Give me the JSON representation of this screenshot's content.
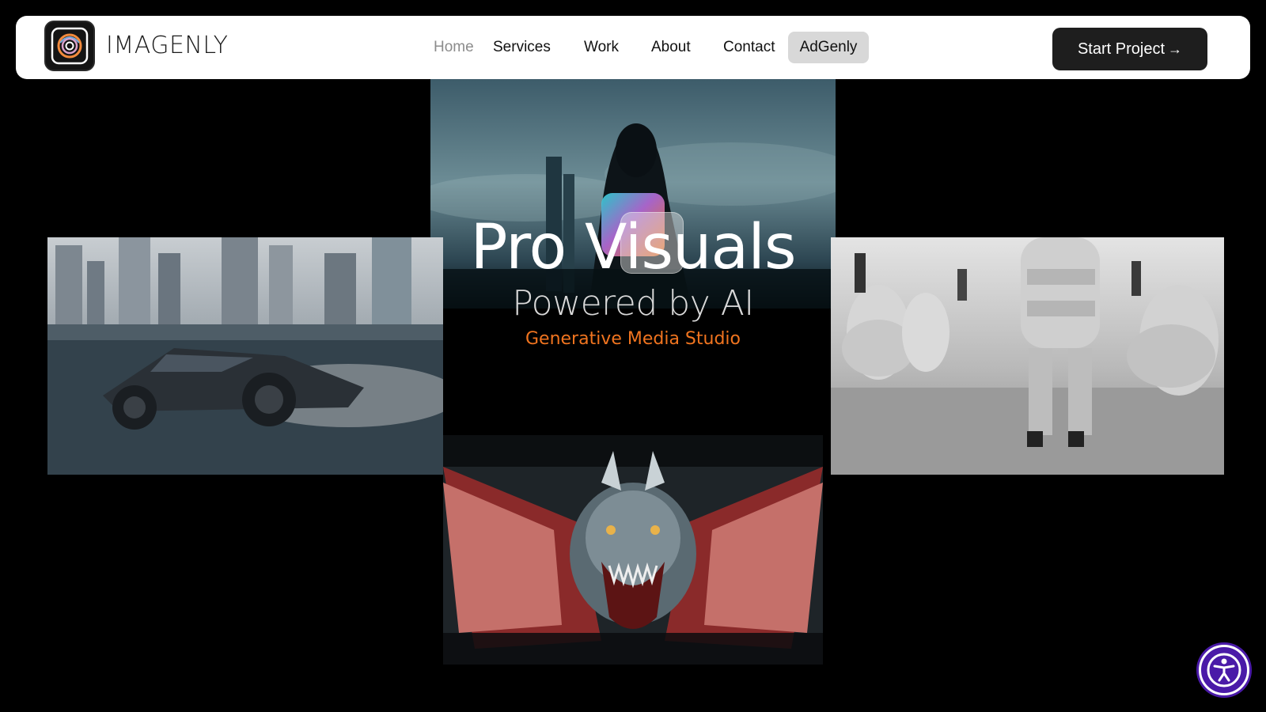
{
  "brand": {
    "name": "IMAGENLY"
  },
  "nav": {
    "items": [
      {
        "label": "Home",
        "state": "active"
      },
      {
        "label": "Services"
      },
      {
        "label": "Work"
      },
      {
        "label": "About"
      },
      {
        "label": "Contact"
      },
      {
        "label": "AdGenly",
        "state": "highlighted"
      }
    ]
  },
  "cta": {
    "label": "Start Project",
    "icon": "arrow-right-icon"
  },
  "hero": {
    "title": "Pro Visuals",
    "subtitle": "Powered by AI",
    "tagline": "Generative Media Studio"
  },
  "gallery": {
    "images": [
      {
        "subject": "hooded figure facing city skyline"
      },
      {
        "subject": "futuristic car on water with skyscrapers"
      },
      {
        "subject": "runway models in puffer outfits"
      },
      {
        "subject": "dragon with red wings"
      }
    ]
  },
  "accessibility": {
    "icon": "accessibility-icon"
  },
  "colors": {
    "accent": "#f0741f",
    "cta_bg": "#1e1e1e",
    "accessibility_bg": "#4a1aa8",
    "page_bg": "#000000"
  }
}
